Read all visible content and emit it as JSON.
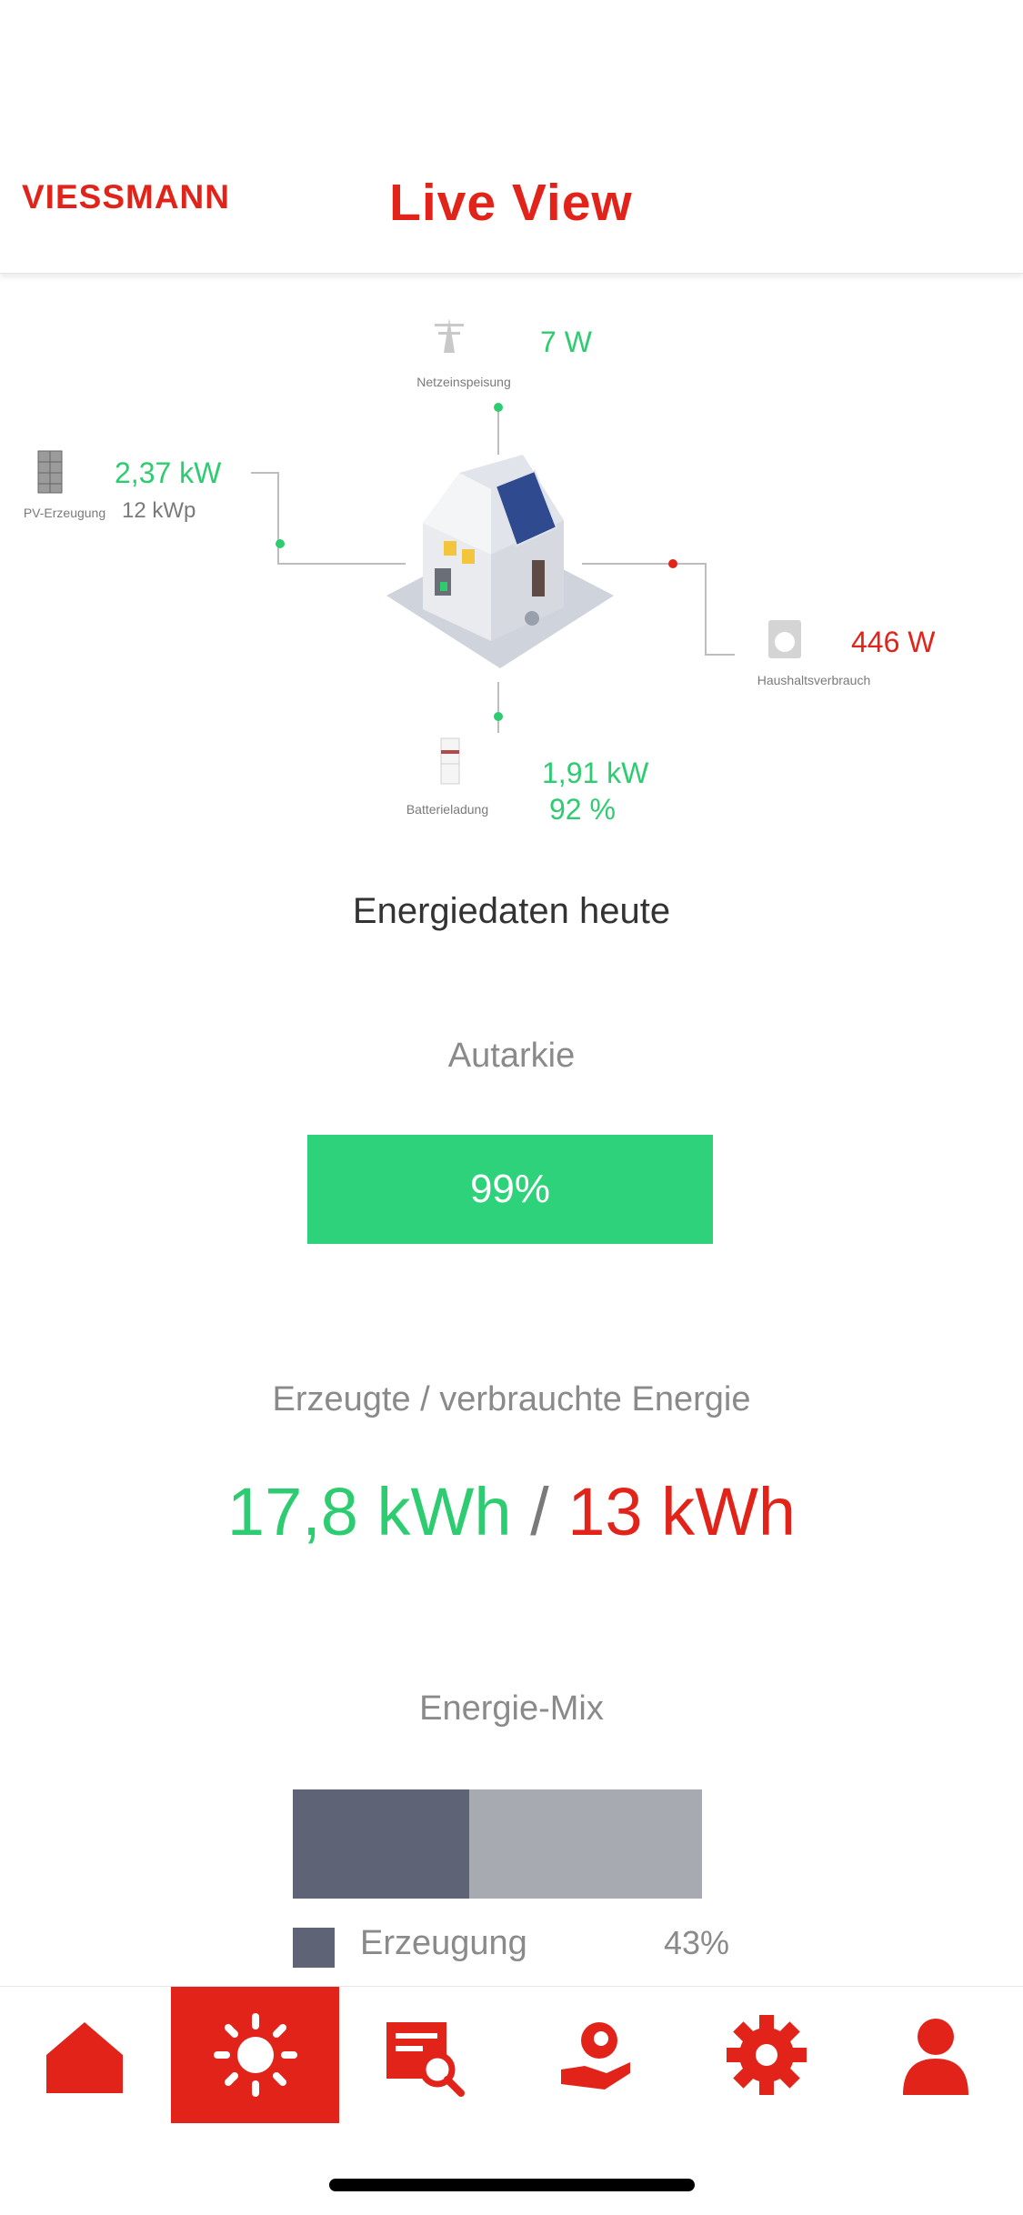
{
  "header": {
    "logo": "VIESSMANN",
    "title": "Live View"
  },
  "flow": {
    "grid": {
      "label": "Netzeinspeisung",
      "value": "7 W"
    },
    "pv": {
      "label": "PV-Erzeugung",
      "value": "2,37 kW",
      "capacity": "12 kWp"
    },
    "household": {
      "label": "Haushaltsverbrauch",
      "value": "446 W"
    },
    "battery": {
      "label": "Batterieladung",
      "value": "1,91 kW",
      "level": "92 %"
    }
  },
  "today": {
    "heading": "Energiedaten heute",
    "autarkie": {
      "title": "Autarkie",
      "value_label": "99%",
      "fraction": 0.99
    },
    "energy": {
      "title": "Erzeugte / verbrauchte Energie",
      "produced": "17,8 kWh",
      "separator": "/",
      "consumed": "13 kWh"
    },
    "mix": {
      "title": "Energie-Mix",
      "legend_label": "Erzeugung",
      "legend_value": "43%",
      "generation_fraction": 0.43
    }
  },
  "tabs": [
    {
      "name": "home",
      "icon": "home-icon",
      "active": false
    },
    {
      "name": "live",
      "icon": "sun-icon",
      "active": true
    },
    {
      "name": "analysis",
      "icon": "search-report-icon",
      "active": false
    },
    {
      "name": "service",
      "icon": "hand-icon",
      "active": false
    },
    {
      "name": "settings",
      "icon": "gear-icon",
      "active": false
    },
    {
      "name": "profile",
      "icon": "user-icon",
      "active": false
    }
  ],
  "colors": {
    "brand": "#e2231a",
    "green": "#2ecc71",
    "mix_dark": "#5e6475",
    "mix_light": "#a7aab1"
  }
}
